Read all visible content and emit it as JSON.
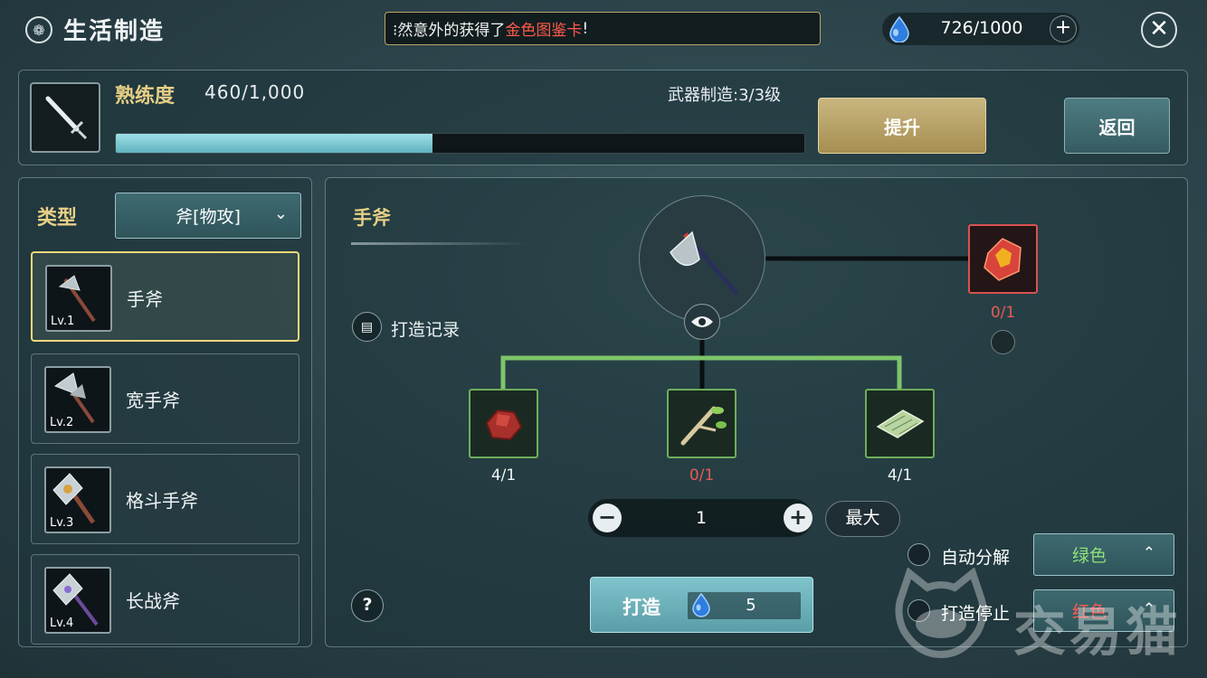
{
  "header": {
    "title": "生活制造",
    "notice_prefix": "⁝然意外的获得了",
    "notice_highlight": "金色图鉴卡",
    "notice_suffix": "!",
    "currency": "726/1000",
    "currency_plus": "+",
    "close_label": "✕"
  },
  "proficiency": {
    "label": "熟练度",
    "value": "460/1,000",
    "progress_fraction": 0.46,
    "weapon_level": "武器制造:3/3级",
    "upgrade_label": "提升",
    "return_label": "返回"
  },
  "left": {
    "type_label": "类型",
    "type_select": "斧[物攻]",
    "items": [
      {
        "name": "手斧",
        "level": "Lv.1",
        "selected": true
      },
      {
        "name": "宽手斧",
        "level": "Lv.2",
        "selected": false
      },
      {
        "name": "格斗手斧",
        "level": "Lv.3",
        "selected": false
      },
      {
        "name": "长战斧",
        "level": "Lv.4",
        "selected": false
      }
    ]
  },
  "recipe": {
    "title": "手斧",
    "record_label": "打造记录",
    "gem_count": "0/1",
    "materials": [
      {
        "count": "4/1",
        "color": "#f0f4f5"
      },
      {
        "count": "0/1",
        "color": "#e85a55"
      },
      {
        "count": "4/1",
        "color": "#f0f4f5"
      }
    ],
    "quantity": "1",
    "qty_minus": "−",
    "qty_plus": "+",
    "max_label": "最大",
    "auto_decompose_label": "自动分解",
    "auto_decompose_value": "绿色",
    "stop_label": "打造停止",
    "stop_value": "红色",
    "help_label": "?",
    "craft_label": "打造",
    "craft_cost": "5"
  },
  "watermark": "交易猫",
  "colors": {
    "gold_text": "#e6cf86",
    "green_quality": "#8fe07a",
    "red_quality": "#ff5a50",
    "highlight_red": "#ff5a4a"
  }
}
